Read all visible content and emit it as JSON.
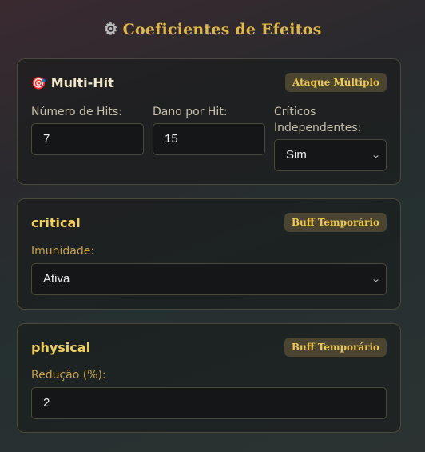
{
  "header": {
    "title": "Coeficientes de Efeitos",
    "icon": "gear-icon"
  },
  "cards": [
    {
      "title": "Multi-Hit",
      "icon": "target-icon",
      "badge": "Ataque Múltiplo",
      "fields": [
        {
          "label": "Número de Hits:",
          "value": "7"
        },
        {
          "label": "Dano por Hit:",
          "value": "15"
        },
        {
          "label": "Críticos Independentes:",
          "value": "Sim"
        }
      ]
    },
    {
      "title": "critical",
      "badge": "Buff Temporário",
      "fields": [
        {
          "label": "Imunidade:",
          "value": "Ativa"
        }
      ]
    },
    {
      "title": "physical",
      "badge": "Buff Temporário",
      "fields": [
        {
          "label": "Redução (%):",
          "value": "2"
        }
      ]
    }
  ]
}
